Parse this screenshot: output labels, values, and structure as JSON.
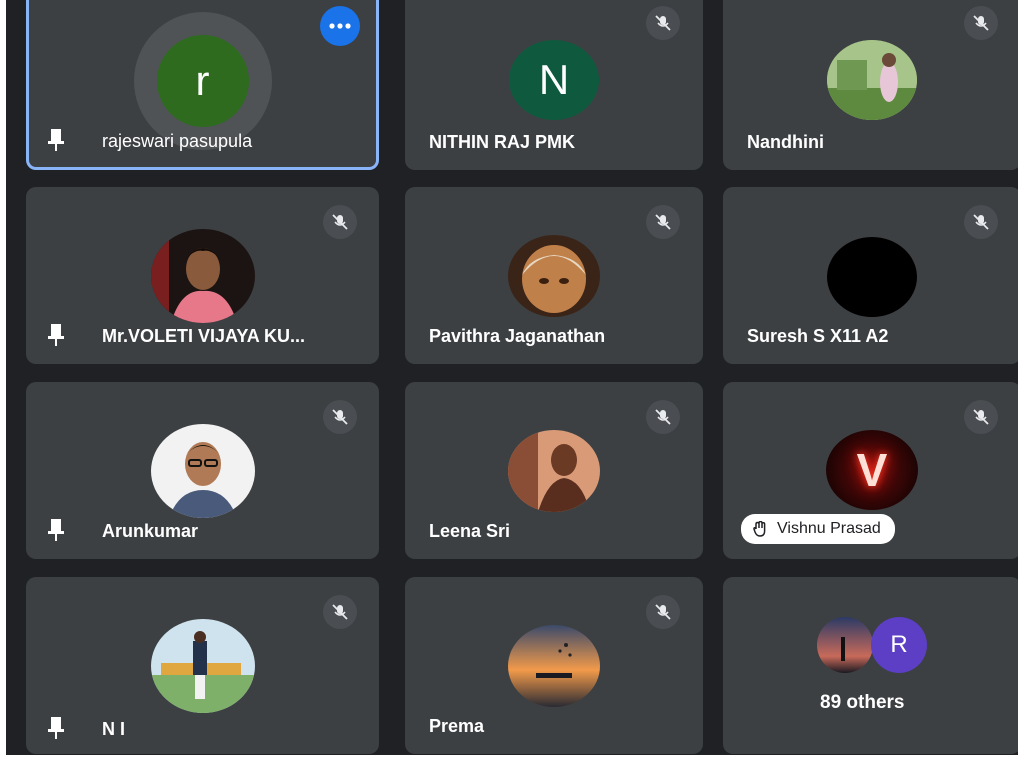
{
  "participants": [
    {
      "name": "rajeswari pasupula",
      "initial": "r",
      "avatar_color": "#2e6b1f",
      "pinned": true,
      "muted": false,
      "active": true
    },
    {
      "name": "NITHIN RAJ PMK",
      "initial": "N",
      "avatar_color": "#0f5a3e",
      "pinned": false,
      "muted": true
    },
    {
      "name": "Nandhini",
      "pinned": false,
      "muted": true
    },
    {
      "name": "Mr.VOLETI VIJAYA KU...",
      "pinned": true,
      "muted": true
    },
    {
      "name": "Pavithra Jaganathan",
      "pinned": false,
      "muted": true
    },
    {
      "name": "Suresh S X11 A2",
      "pinned": false,
      "muted": true
    },
    {
      "name": "Arunkumar",
      "pinned": true,
      "muted": true
    },
    {
      "name": "Leena Sri",
      "pinned": false,
      "muted": true
    },
    {
      "name": "Vishnu Prasad",
      "initial": "V",
      "pinned": false,
      "muted": true,
      "raised_hand": true
    },
    {
      "name": "N I",
      "pinned": true,
      "muted": true
    },
    {
      "name": "Prema",
      "pinned": false,
      "muted": true
    }
  ],
  "others": {
    "label": "89 others",
    "initial": "R",
    "avatar_color": "#5c3fc4"
  },
  "colors": {
    "background": "#202124",
    "tile": "#3c4043",
    "accent": "#1a73e8",
    "active_border": "#8ab4f8"
  },
  "icons": {
    "pin": "pin-icon",
    "mute": "mic-off-icon",
    "more": "more-options-icon",
    "hand": "raised-hand-icon"
  }
}
